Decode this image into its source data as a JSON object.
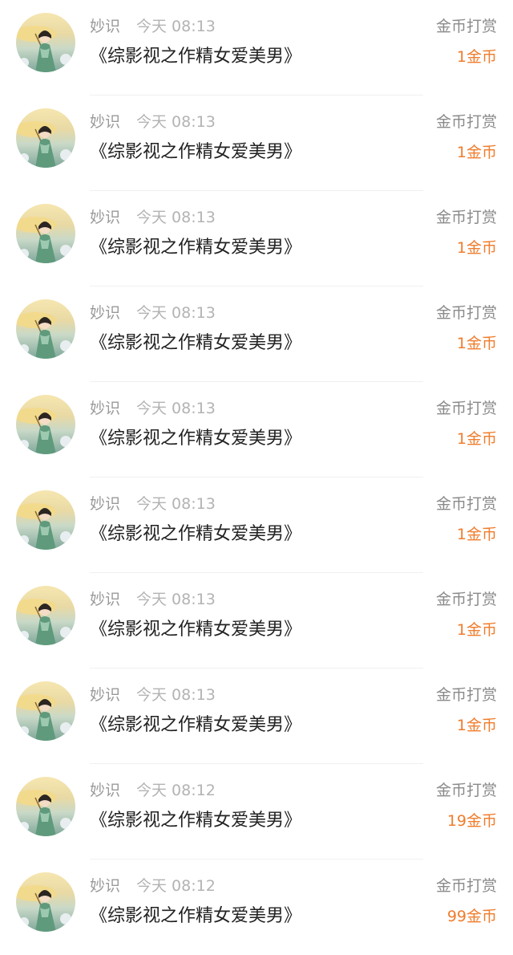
{
  "rewards": [
    {
      "user": "妙识",
      "time": "今天 08:13",
      "book": "《综影视之作精女爱美男》",
      "type": "金币打赏",
      "amount": "1金币"
    },
    {
      "user": "妙识",
      "time": "今天 08:13",
      "book": "《综影视之作精女爱美男》",
      "type": "金币打赏",
      "amount": "1金币"
    },
    {
      "user": "妙识",
      "time": "今天 08:13",
      "book": "《综影视之作精女爱美男》",
      "type": "金币打赏",
      "amount": "1金币"
    },
    {
      "user": "妙识",
      "time": "今天 08:13",
      "book": "《综影视之作精女爱美男》",
      "type": "金币打赏",
      "amount": "1金币"
    },
    {
      "user": "妙识",
      "time": "今天 08:13",
      "book": "《综影视之作精女爱美男》",
      "type": "金币打赏",
      "amount": "1金币"
    },
    {
      "user": "妙识",
      "time": "今天 08:13",
      "book": "《综影视之作精女爱美男》",
      "type": "金币打赏",
      "amount": "1金币"
    },
    {
      "user": "妙识",
      "time": "今天 08:13",
      "book": "《综影视之作精女爱美男》",
      "type": "金币打赏",
      "amount": "1金币"
    },
    {
      "user": "妙识",
      "time": "今天 08:13",
      "book": "《综影视之作精女爱美男》",
      "type": "金币打赏",
      "amount": "1金币"
    },
    {
      "user": "妙识",
      "time": "今天 08:12",
      "book": "《综影视之作精女爱美男》",
      "type": "金币打赏",
      "amount": "19金币"
    },
    {
      "user": "妙识",
      "time": "今天 08:12",
      "book": "《综影视之作精女爱美男》",
      "type": "金币打赏",
      "amount": "99金币"
    }
  ],
  "colors": {
    "amount": "#f07c2c",
    "title": "#222222",
    "meta": "#9a9a9a"
  },
  "icons": {
    "avatar": "user-avatar-icon"
  }
}
